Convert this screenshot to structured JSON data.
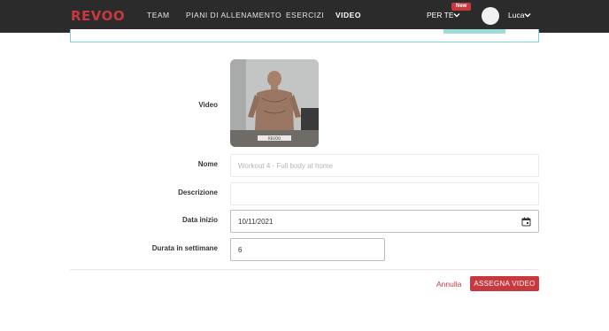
{
  "header": {
    "logo": "REVOO",
    "nav": [
      "TEAM",
      "PIANI DI ALLENAMENTO",
      "ESERCIZI",
      "VIDEO"
    ],
    "active_nav": "VIDEO",
    "per_te": "PER TE",
    "new_badge": "New",
    "user_name": "Luca"
  },
  "form": {
    "video_label": "Video",
    "video_thumbnail_caption": "REVOO",
    "name_label": "Nome",
    "name_placeholder": "Workout 4 - Full body at home",
    "description_label": "Descrizione",
    "description_value": "",
    "start_date_label": "Data inizio",
    "start_date_value": "10/11/2021",
    "duration_label": "Durata in settimane",
    "duration_value": "6"
  },
  "actions": {
    "cancel": "Annulla",
    "assign": "ASSEGNA VIDEO"
  },
  "colors": {
    "brand": "#c8383f",
    "topbar": "#2b2b2b",
    "teal_border": "#7fd3d0"
  }
}
